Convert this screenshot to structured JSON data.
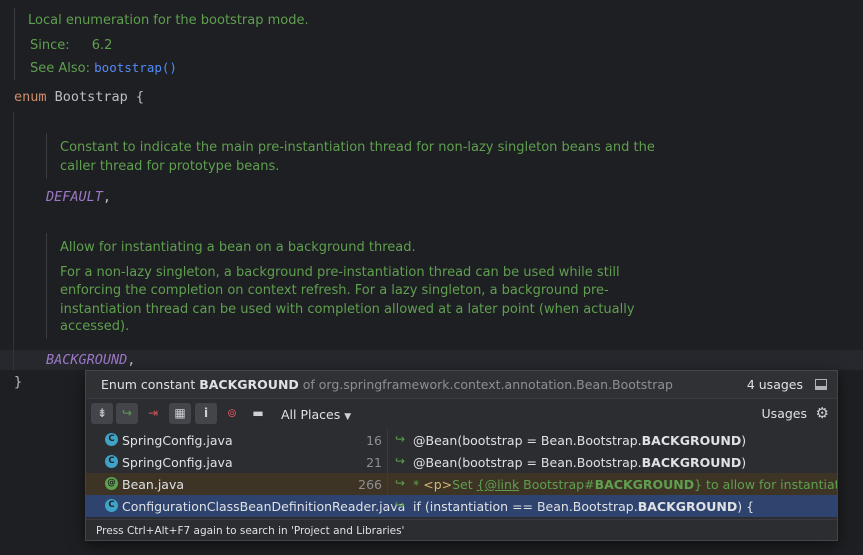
{
  "editor": {
    "doc1": {
      "description": "Local enumeration for the bootstrap mode.",
      "since_label": "Since:",
      "since_value": "6.2",
      "see_also_label": "See Also:",
      "see_also_link": "bootstrap()"
    },
    "enum_keyword": "enum",
    "enum_decl": "Bootstrap {",
    "doc_default": {
      "line1": "Constant to indicate the main pre-instantiation thread for non-lazy singleton beans and the",
      "line2": "caller thread for prototype beans."
    },
    "const_default": "DEFAULT",
    "comma": ",",
    "doc_background": {
      "line1": "Allow for instantiating a bean on a background thread.",
      "line2": "For a non-lazy singleton, a background pre-instantiation thread can be used while still",
      "line3": "enforcing the completion on context refresh. For a lazy singleton, a background pre-",
      "line4": "instantiation thread can be used with completion allowed at a later point (when actually",
      "line5": "accessed)."
    },
    "const_background": "BACKGROUND",
    "closing_brace": "}"
  },
  "popup": {
    "title_prefix": "Enum constant",
    "title_name": "BACKGROUND",
    "title_of": "of org.springframework.context.annotation.Bean.Bootstrap",
    "usages_count": "4 usages",
    "scope": "All Places",
    "usages_label": "Usages",
    "footer": "Press Ctrl+Alt+F7 again to search in 'Project and Libraries'",
    "toolbar_icons": [
      "merge-usages-icon",
      "navigate-next-icon",
      "navigate-exclude-icon",
      "group-by-file-icon",
      "info-icon",
      "filter-icon",
      "preview-icon"
    ],
    "rows": [
      {
        "icon": "C",
        "file": "SpringConfig.java",
        "line": "16",
        "pre": "@Bean(bootstrap = Bean.Bootstrap.",
        "match": "BACKGROUND",
        "post": ")"
      },
      {
        "icon": "C",
        "file": "SpringConfig.java",
        "line": "21",
        "pre": "@Bean(bootstrap = Bean.Bootstrap.",
        "match": "BACKGROUND",
        "post": ")"
      },
      {
        "icon": "@",
        "file": "Bean.java",
        "line": "266",
        "pre_star": "* ",
        "pre_tag": "<p>",
        "pre_text": "Set ",
        "pre_link": "{@link",
        "pre_ref": " Bootstrap#",
        "match": "BACKGROUND",
        "post": "} to allow for instantiating this"
      },
      {
        "icon": "C",
        "file": "ConfigurationClassBeanDefinitionReader.java",
        "line": "",
        "pre": "if (instantiation == Bean.Bootstrap.",
        "match": "BACKGROUND",
        "post": ") {"
      }
    ]
  }
}
